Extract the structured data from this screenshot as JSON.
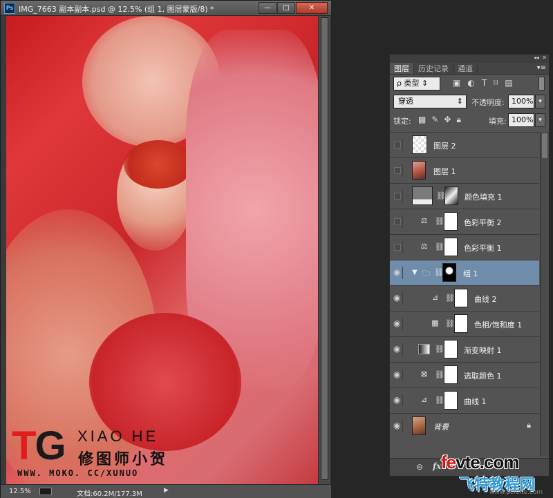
{
  "document": {
    "app_logo": "Ps",
    "title": "IMG_7663 副本副本.psd @ 12.5% (组 1, 图层蒙版/8) *",
    "buttons": {
      "minimize": "—",
      "maximize": "□",
      "close": "✕"
    },
    "status": {
      "zoom": "12.5%",
      "doc_size": "文档:60.2M/177.3M",
      "arrow": "▶"
    }
  },
  "watermark": {
    "tg_t": "T",
    "tg_g": "G",
    "en": "XIAO HE",
    "cn": "修图师小贺",
    "url": "WWW. MOKO. CC/XUNUO"
  },
  "panel": {
    "tabs": [
      "图层",
      "历史记录",
      "通道"
    ],
    "active_tab": "图层",
    "filter": {
      "label": "ρ 类型",
      "arrow": "⇕"
    },
    "blend_mode": "穿透",
    "opacity_label": "不透明度:",
    "opacity_value": "100%",
    "lock_label": "锁定:",
    "fill_label": "填充:",
    "fill_value": "100%",
    "layers": [
      {
        "name": "图层 2",
        "visible": false,
        "kind": "pixel-transparent"
      },
      {
        "name": "图层 1",
        "visible": false,
        "kind": "pixel-photo"
      },
      {
        "name": "颜色填充 1",
        "visible": false,
        "kind": "fill"
      },
      {
        "name": "色彩平衡 2",
        "visible": false,
        "kind": "balance"
      },
      {
        "name": "色彩平衡 1",
        "visible": false,
        "kind": "balance"
      },
      {
        "name": "组 1",
        "visible": true,
        "kind": "group",
        "selected": true
      },
      {
        "name": "曲线 2",
        "visible": true,
        "kind": "curves",
        "indent": true
      },
      {
        "name": "色相/饱和度 1",
        "visible": true,
        "kind": "huesat",
        "indent": true
      },
      {
        "name": "渐变映射 1",
        "visible": true,
        "kind": "gradient"
      },
      {
        "name": "选取颜色 1",
        "visible": true,
        "kind": "selective"
      },
      {
        "name": "曲线 1",
        "visible": true,
        "kind": "curves"
      },
      {
        "name": "背景",
        "visible": true,
        "kind": "background",
        "locked": true
      }
    ],
    "bottom": {
      "link": "⊖",
      "fx": "fx"
    }
  },
  "site": {
    "a": "fe",
    "b": "vte.com",
    "c": "飞特教程网",
    "d": "www.pcfeite.com"
  }
}
